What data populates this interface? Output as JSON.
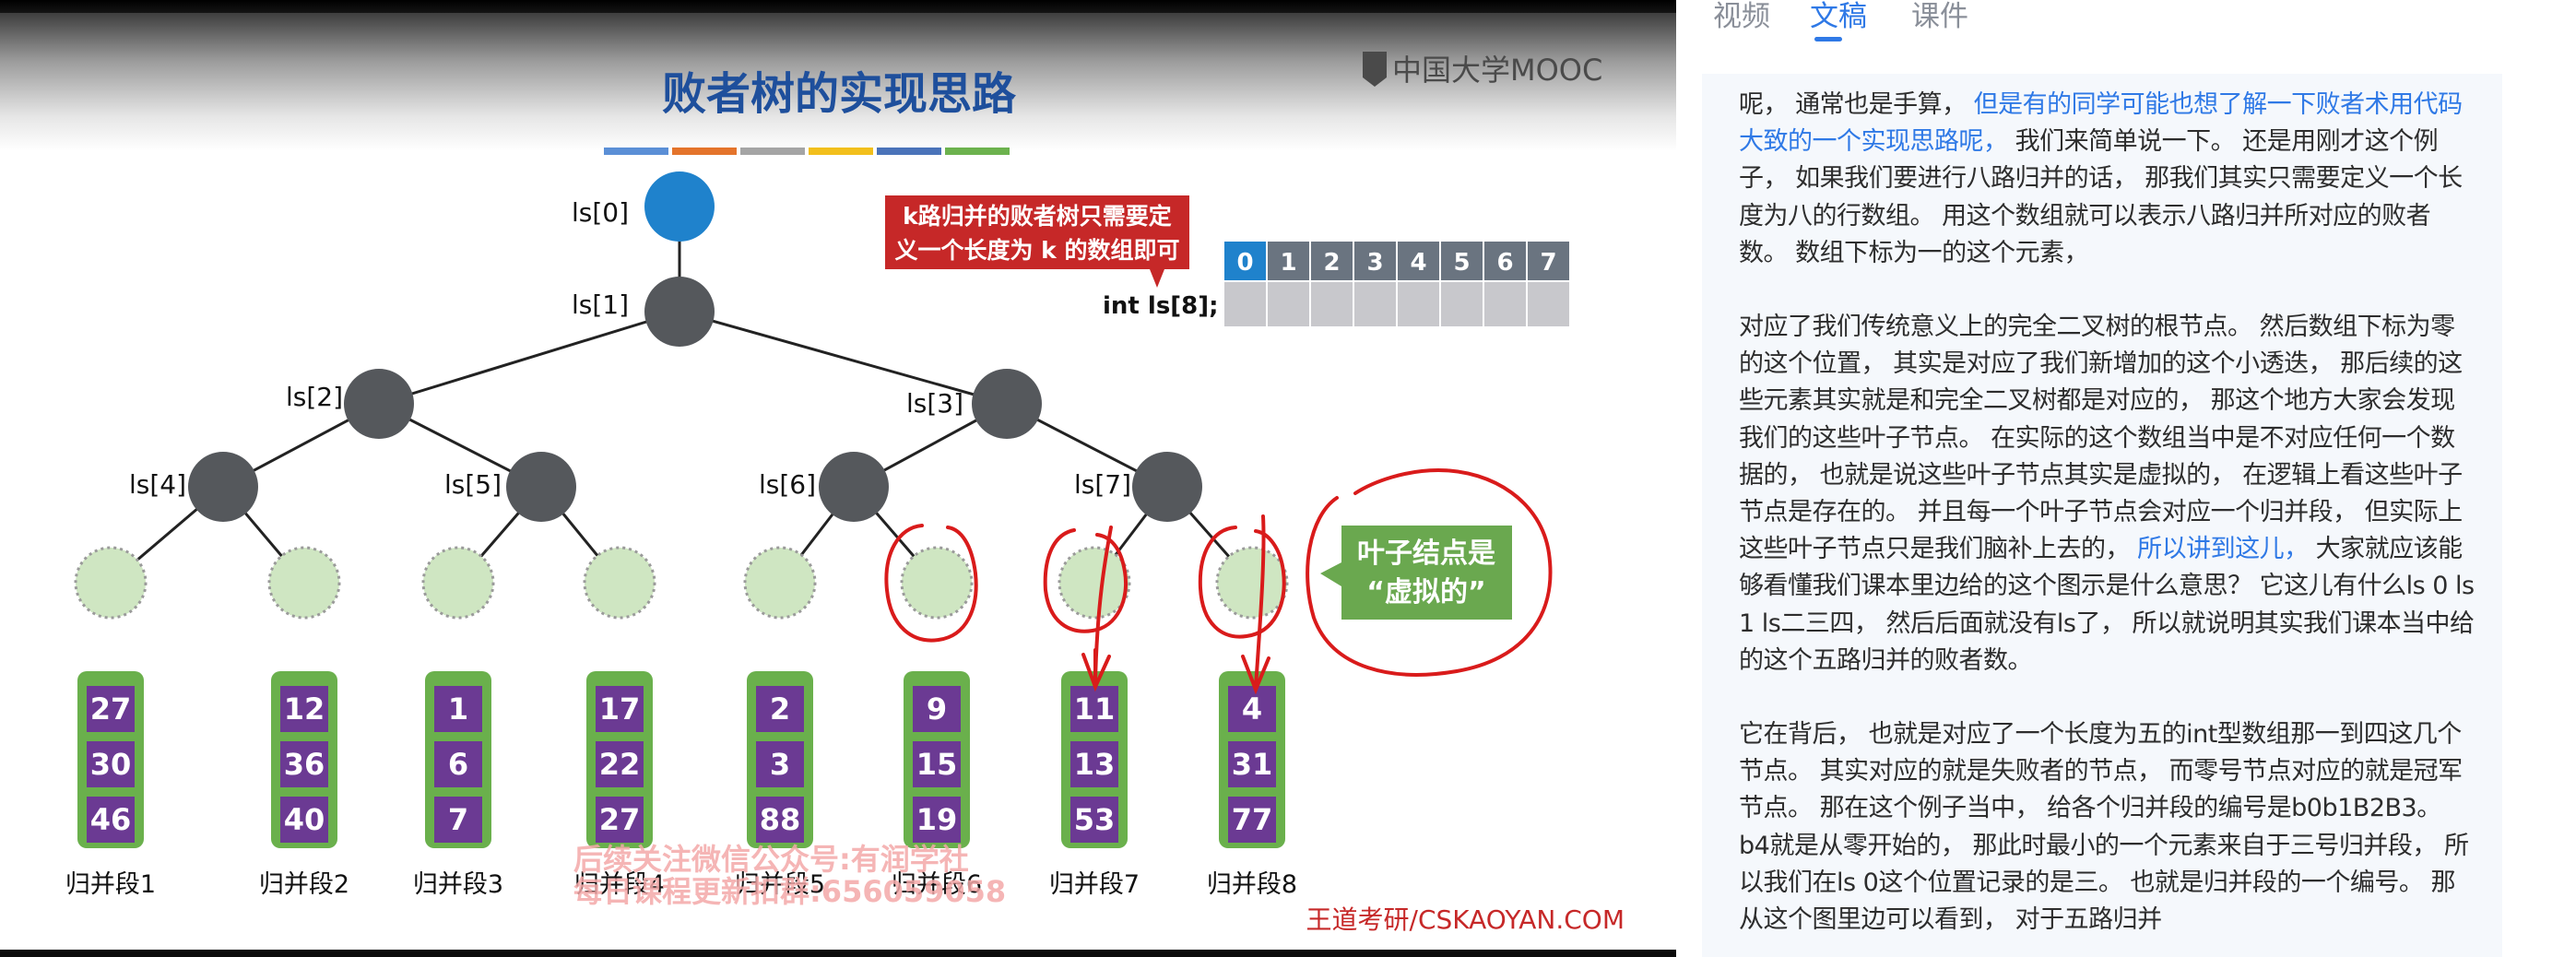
{
  "slide": {
    "title": "败者树的实现思路",
    "logo": "中国大学MOOC",
    "footer": "王道考研/CSKAOYAN.COM",
    "callout_k": [
      "k路归并的败者树只需要定",
      "义一个长度为 k 的数组即可"
    ],
    "array_declaration": "int ls[8];",
    "array_indices": [
      "0",
      "1",
      "2",
      "3",
      "4",
      "5",
      "6",
      "7"
    ],
    "node_labels": [
      "ls[0]",
      "ls[1]",
      "ls[2]",
      "ls[3]",
      "ls[4]",
      "ls[5]",
      "ls[6]",
      "ls[7]"
    ],
    "leaf_callout": [
      "叶子结点是",
      "“虚拟的”"
    ],
    "merge_segments": [
      {
        "label": "归并段1",
        "values": [
          "27",
          "30",
          "46"
        ]
      },
      {
        "label": "归并段2",
        "values": [
          "12",
          "36",
          "40"
        ]
      },
      {
        "label": "归并段3",
        "values": [
          "1",
          "6",
          "7"
        ]
      },
      {
        "label": "归并段4",
        "values": [
          "17",
          "22",
          "27"
        ]
      },
      {
        "label": "归并段5",
        "values": [
          "2",
          "3",
          "88"
        ]
      },
      {
        "label": "归并段6",
        "values": [
          "9",
          "15",
          "19"
        ]
      },
      {
        "label": "归并段7",
        "values": [
          "11",
          "13",
          "53"
        ]
      },
      {
        "label": "归并段8",
        "values": [
          "4",
          "31",
          "77"
        ]
      }
    ],
    "watermark": [
      "后续关注微信公众号:有润学社",
      "每日课程更新扣群:656059058"
    ],
    "colors": {
      "root_node": "#1f82cc",
      "internal_node": "#55585c",
      "leaf_fill": "#cfe6c2",
      "segment_frame": "#6ab04c",
      "segment_cell": "#6b3a93",
      "callout_red": "#c62828",
      "callout_green": "#6aa84f",
      "array_header": "#6a7480",
      "annotation_red": "#d91b1b",
      "title_blue": "#1e4f9c"
    },
    "title_underline_colors": [
      "#5b8fd6",
      "#e4742b",
      "#a5a5a5",
      "#f2bf1c",
      "#4a73b9",
      "#6cb24e"
    ]
  },
  "tabs": [
    "视频",
    "文稿",
    "课件"
  ],
  "active_tab": "文稿",
  "transcript": [
    [
      {
        "text": "呢， 通常也是手算， "
      },
      {
        "text": "但是有的同学可能也想了解一下败者术用代码大致的一个实现思路呢，",
        "highlight": true
      },
      {
        "text": " 我们来简单说一下。 还是用刚才这个例子， 如果我们要进行八路归并的话， 那我们其实只需要定义一个长度为八的行数组。 用这个数组就可以表示八路归并所对应的败者数。 数组下标为一的这个元素，"
      }
    ],
    [
      {
        "text": "对应了我们传统意义上的完全二叉树的根节点。 然后数组下标为零的这个位置， 其实是对应了我们新增加的这个小透迭， 那后续的这些元素其实就是和完全二叉树都是对应的， 那这个地方大家会发现我们的这些叶子节点。 在实际的这个数组当中是不对应任何一个数据的， 也就是说这些叶子节点其实是虚拟的， 在逻辑上看这些叶子节点是存在的。 并且每一个叶子节点会对应一个归并段， 但实际上这些叶子节点只是我们脑补上去的， "
      },
      {
        "text": "所以讲到这儿，",
        "highlight": true
      },
      {
        "text": " 大家就应该能够看懂我们课本里边给的这个图示是什么意思？ 它这儿有什么ls 0 ls 1 ls二三四， 然后后面就没有ls了， 所以就说明其实我们课本当中给的这个五路归并的败者数。"
      }
    ],
    [
      {
        "text": "它在背后， 也就是对应了一个长度为五的int型数组那一到四这几个节点。 其实对应的就是失败者的节点， 而零号节点对应的就是冠军节点。 那在这个例子当中， 给各个归并段的编号是b0b1B2B3。 b4就是从零开始的， 那此时最小的一个元素来自于三号归并段， 所以我们在ls 0这个位置记录的是三。 也就是归并段的一个编号。 那从这个图里边可以看到， 对于五路归并"
      }
    ]
  ]
}
